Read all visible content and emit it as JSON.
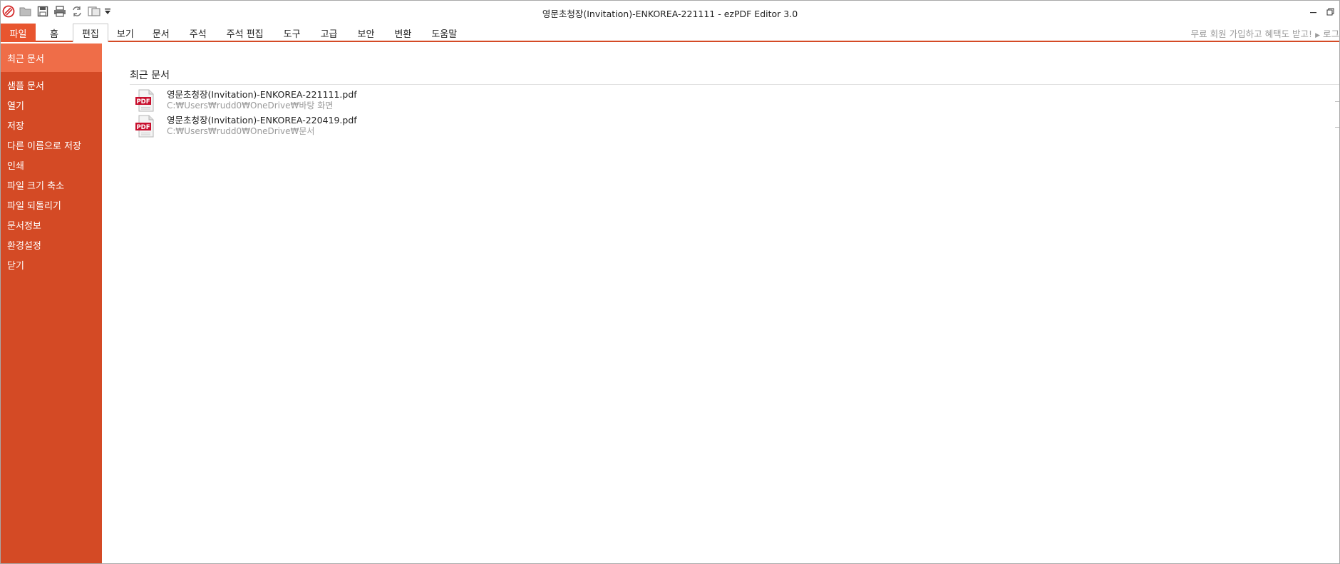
{
  "window": {
    "title": "영문초청장(Invitation)-ENKOREA-221111 -  ezPDF Editor 3.0"
  },
  "quick_access": [
    "app-logo-icon",
    "open-folder-icon",
    "save-icon",
    "print-icon",
    "refresh-icon",
    "pages-icon",
    "customize-dropdown-icon"
  ],
  "tabs": [
    {
      "label": "파일"
    },
    {
      "label": "홈"
    },
    {
      "label": "편집"
    },
    {
      "label": "보기"
    },
    {
      "label": "문서"
    },
    {
      "label": "주석"
    },
    {
      "label": "주석 편집"
    },
    {
      "label": "도구"
    },
    {
      "label": "고급"
    },
    {
      "label": "보안"
    },
    {
      "label": "변환"
    },
    {
      "label": "도움말"
    }
  ],
  "promo": {
    "text": "무료 회원 가입하고 혜택도 받고!",
    "login": "로그"
  },
  "sidebar": {
    "items": [
      {
        "label": "최근 문서"
      },
      {
        "label": "샘플 문서"
      },
      {
        "label": "열기"
      },
      {
        "label": "저장"
      },
      {
        "label": "다른 이름으로 저장"
      },
      {
        "label": "인쇄"
      },
      {
        "label": "파일 크기 축소"
      },
      {
        "label": "파일 되돌리기"
      },
      {
        "label": "문서정보"
      },
      {
        "label": "환경설정"
      },
      {
        "label": "닫기"
      }
    ]
  },
  "recent": {
    "title": "최근 문서",
    "icon_label": "PDF",
    "documents": [
      {
        "name": "영문초청장(Invitation)-ENKOREA-221111.pdf",
        "path": "C:₩Users₩rudd0₩OneDrive₩바탕 화면"
      },
      {
        "name": "영문초청장(Invitation)-ENKOREA-220419.pdf",
        "path": "C:₩Users₩rudd0₩OneDrive₩문서"
      }
    ]
  },
  "colors": {
    "accent": "#d44a25",
    "accent_selected": "#ef6d48",
    "file_tab": "#e8552f",
    "pdf_red": "#c8102e"
  }
}
